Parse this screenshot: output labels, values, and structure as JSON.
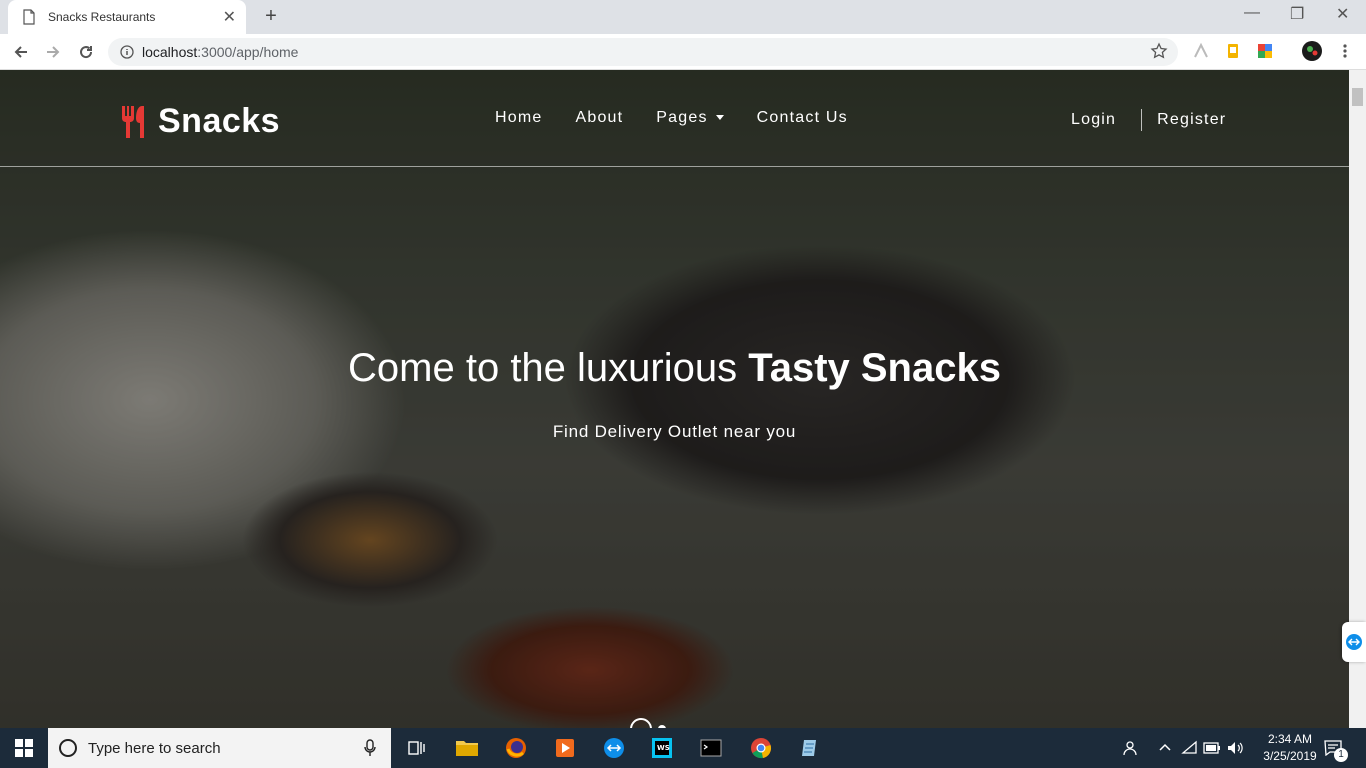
{
  "browser": {
    "tab_title": "Snacks Restaurants",
    "url_host": "localhost",
    "url_path": ":3000/app/home",
    "page_icon": "document-icon"
  },
  "site": {
    "brand": "Snacks",
    "brand_color": "#e53935",
    "nav": [
      {
        "label": "Home"
      },
      {
        "label": "About"
      },
      {
        "label": "Pages",
        "dropdown": true
      },
      {
        "label": "Contact Us"
      }
    ],
    "auth": {
      "login": "Login",
      "register": "Register"
    },
    "hero": {
      "title_regular": "Come to the luxurious ",
      "title_bold": "Tasty Snacks",
      "subtitle": "Find Delivery Outlet near you"
    },
    "carousel": {
      "slides": 2,
      "active_index": 0
    }
  },
  "taskbar": {
    "search_placeholder": "Type here to search",
    "time": "2:34 AM",
    "date": "3/25/2019",
    "notification_count": "1",
    "apps": [
      "file-explorer-icon",
      "firefox-icon",
      "media-player-icon",
      "teamviewer-icon",
      "webstorm-icon",
      "terminal-icon",
      "chrome-icon",
      "notepad-icon"
    ]
  }
}
